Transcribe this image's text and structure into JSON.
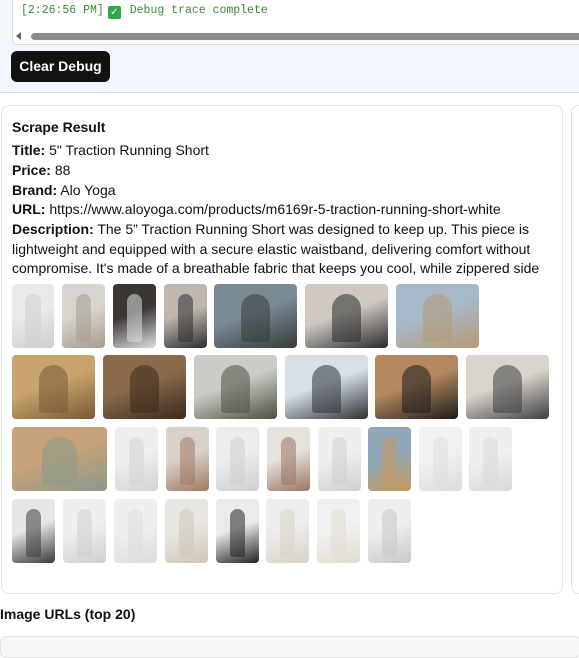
{
  "debug": {
    "log_timestamp": "[2:26:56 PM]",
    "log_message": "Debug trace complete",
    "clear_button_label": "Clear Debug"
  },
  "result": {
    "heading": "Scrape Result",
    "title_label": "Title:",
    "title_value": "5\" Traction Running Short",
    "price_label": "Price:",
    "price_value": "88",
    "brand_label": "Brand:",
    "brand_value": "Alo Yoga",
    "url_label": "URL:",
    "url_value": "https://www.aloyoga.com/products/m6169r-5-traction-running-short-white",
    "description_label": "Description:",
    "description_value": "The 5” Traction Running Short was designed to keep up. This piece is lightweight and equipped with a secure elastic waistband, delivering comfort without compromise. It's made of a breathable fabric that keeps you cool, while zippered side",
    "images": [
      {
        "name": "model-white-shorts-front"
      },
      {
        "name": "legs-with-sneakers"
      },
      {
        "name": "white-sneakers"
      },
      {
        "name": "model-dark-pants"
      },
      {
        "name": "model-lying-on-rock"
      },
      {
        "name": "model-sports-bra"
      },
      {
        "name": "model-desert"
      },
      {
        "name": "model-splits-on-bench"
      },
      {
        "name": "model-sitting-rocks"
      },
      {
        "name": "sneakers-on-rock"
      },
      {
        "name": "model-beach-bra"
      },
      {
        "name": "model-white-tee"
      },
      {
        "name": "model-motorcycle"
      },
      {
        "name": "model-sitting-desert"
      },
      {
        "name": "shorts-front"
      },
      {
        "name": "model-shirtless-shorts"
      },
      {
        "name": "shorts-side"
      },
      {
        "name": "model-shorts-back"
      },
      {
        "name": "shorts-angle"
      },
      {
        "name": "model-running-shorts"
      },
      {
        "name": "white-socks"
      },
      {
        "name": "white-sneaker"
      },
      {
        "name": "model-dark-shorts"
      },
      {
        "name": "shorts-front-2"
      },
      {
        "name": "model-cream-pants"
      },
      {
        "name": "model-light-shorts"
      },
      {
        "name": "model-black-top"
      },
      {
        "name": "model-cream-sweats"
      },
      {
        "name": "model-white-sweats"
      },
      {
        "name": "model-grey-sweats"
      }
    ]
  },
  "image_urls_heading": "Image URLs (top 20)"
}
